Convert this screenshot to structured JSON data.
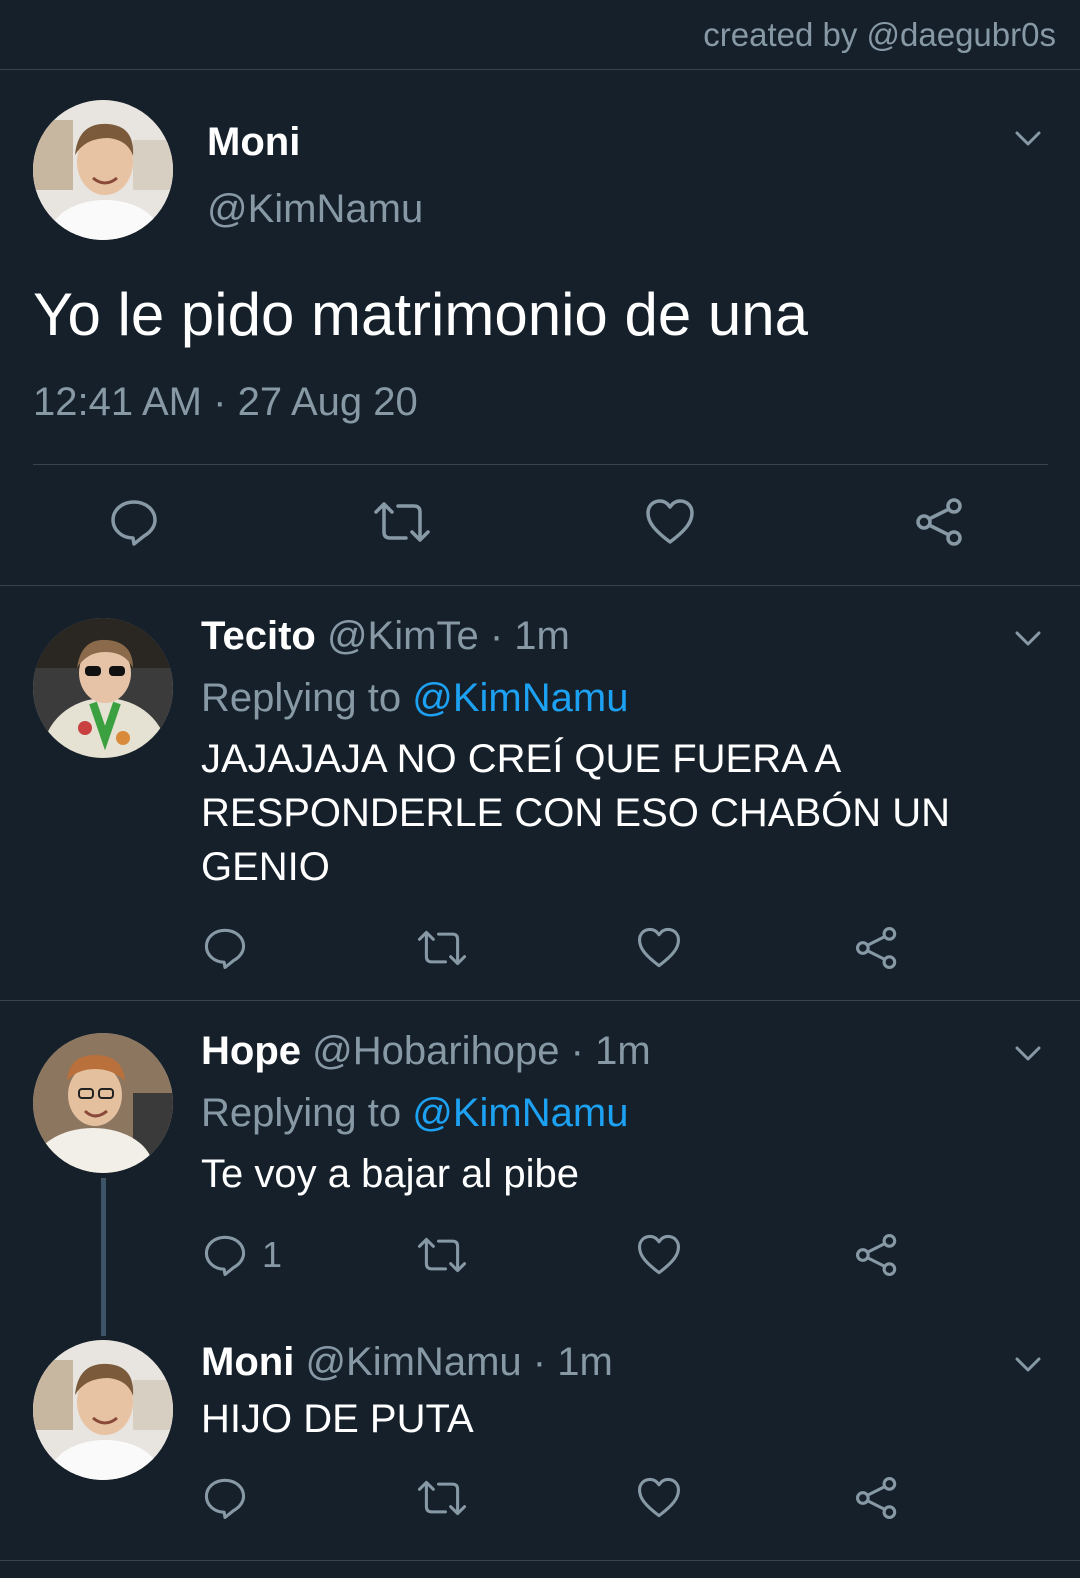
{
  "credit": "created by @daegubr0s",
  "main_tweet": {
    "name": "Moni",
    "handle": "@KimNamu",
    "text": "Yo le pido matrimonio de una",
    "time": "12:41 AM",
    "sep": "·",
    "date": "27 Aug 20"
  },
  "replies": [
    {
      "name": "Tecito",
      "handle": "@KimTe",
      "sep": "·",
      "time": "1m",
      "replying_label": "Replying to",
      "replying_to": "@KimNamu",
      "text": "JAJAJAJA NO CREÍ QUE FUERA A RESPONDERLE CON ESO CHABÓN UN GENIO"
    },
    {
      "name": "Hope",
      "handle": "@Hobarihope",
      "sep": "·",
      "time": "1m",
      "replying_label": "Replying to",
      "replying_to": "@KimNamu",
      "text": "Te voy a bajar al pibe",
      "reply_count": "1"
    },
    {
      "name": "Moni",
      "handle": "@KimNamu",
      "sep": "·",
      "time": "1m",
      "text": "HIJO DE PUTA"
    }
  ],
  "icons": {
    "reply": "reply-bubble-icon",
    "retweet": "retweet-icon",
    "like": "heart-icon",
    "share": "share-icon",
    "more": "chevron-down-icon"
  },
  "colors": {
    "background": "#15202b",
    "divider": "#38444d",
    "secondary_text": "#8899a6",
    "link": "#1da1f2"
  }
}
